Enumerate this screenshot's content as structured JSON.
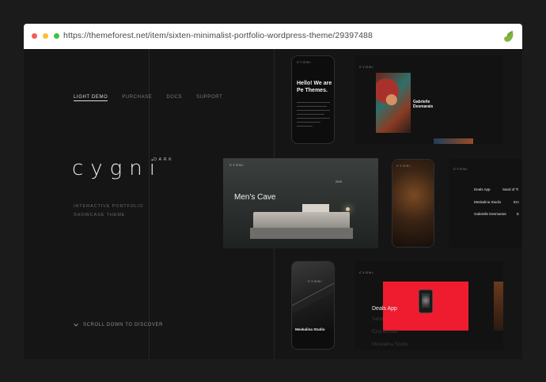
{
  "browser": {
    "url": "https://themeforest.net/item/sixten-minimalist-portfolio-wordpress-theme/29397488",
    "extension_icon": "envato-leaf-icon",
    "traffic_lights": [
      "#f25f58",
      "#fbbe3b",
      "#3ac43f"
    ]
  },
  "nav": {
    "items": [
      {
        "label": "LIGHT DEMO",
        "active": true
      },
      {
        "label": "PURCHASE",
        "active": false
      },
      {
        "label": "DOCS",
        "active": false
      },
      {
        "label": "SUPPORT",
        "active": false
      }
    ]
  },
  "brand": {
    "logo": "cygni",
    "variant": "DARK",
    "tagline_line1": "INTERACTIVE PORTFOLIO",
    "tagline_line2": "SHOWCASE THEME"
  },
  "scroll_cta": "SCROLL DOWN TO DISCOVER",
  "previews": {
    "phone1": {
      "logo": "CYGNI",
      "heading_line1": "Hello! We are",
      "heading_line2": "Pe Themes."
    },
    "screen1": {
      "logo": "CYGNI",
      "name_line1": "Gabrielle",
      "name_line2": "Desmarais"
    },
    "screen2": {
      "logo": "CYGNI",
      "title": "Men's Cave",
      "counter": "2019"
    },
    "phone2": {
      "logo": "CYGNI"
    },
    "screen3": {
      "logo": "CYGNI",
      "items": [
        "Deals App",
        "Sand of Ti",
        "Meskalina Studio",
        "Em",
        "Gabrielle Desmarais",
        "E"
      ]
    },
    "phone3": {
      "logo": "CYGNI",
      "caption": "Meskalina Studio"
    },
    "screen4": {
      "logo": "CYGNI",
      "featured": "Deals App",
      "faded_items": [
        "Sand",
        "Ezra Brooks",
        "Meskalina Studio"
      ]
    }
  },
  "colors": {
    "accent_red": "#ee1c2e",
    "background": "#151515"
  }
}
